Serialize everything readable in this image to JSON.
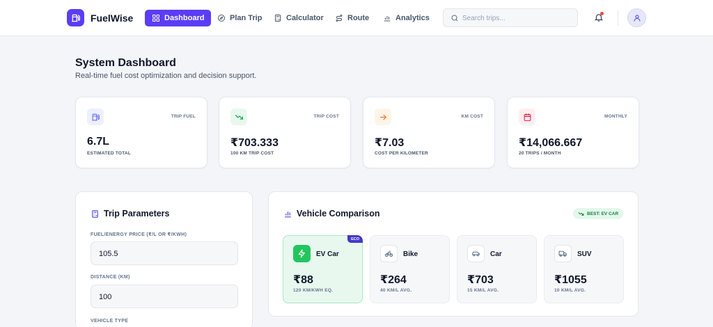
{
  "header": {
    "brand": "FuelWise",
    "nav": [
      {
        "label": "Dashboard",
        "icon": "grid-icon",
        "active": true
      },
      {
        "label": "Plan Trip",
        "icon": "compass-icon",
        "active": false
      },
      {
        "label": "Calculator",
        "icon": "calculator-icon",
        "active": false
      },
      {
        "label": "Route",
        "icon": "route-icon",
        "active": false
      },
      {
        "label": "Analytics",
        "icon": "bar-chart-icon",
        "active": false
      }
    ],
    "search_placeholder": "Search trips...",
    "notifications_unread": true
  },
  "page": {
    "title": "System Dashboard",
    "subtitle": "Real-time fuel cost optimization and decision support."
  },
  "kpis": [
    {
      "tag": "TRIP FUEL",
      "value": "6.7L",
      "caption": "ESTIMATED TOTAL",
      "icon": "fuel-pump-icon",
      "color": "#6366f1"
    },
    {
      "tag": "TRIP COST",
      "value": "₹703.333",
      "caption": "100 KM TRIP COST",
      "icon": "trend-down-icon",
      "color": "#16a34a"
    },
    {
      "tag": "KM COST",
      "value": "₹7.03",
      "caption": "COST PER KILOMETER",
      "icon": "arrow-right-icon",
      "color": "#f97316"
    },
    {
      "tag": "MONTHLY",
      "value": "₹14,066.667",
      "caption": "20 TRIPS / MONTH",
      "icon": "calendar-icon",
      "color": "#e11d48"
    }
  ],
  "trip_parameters": {
    "title": "Trip Parameters",
    "fields": [
      {
        "label": "FUEL/ENERGY PRICE (₹/L OR ₹/KWH)",
        "value": "105.5"
      },
      {
        "label": "DISTANCE (KM)",
        "value": "100"
      },
      {
        "label": "VEHICLE TYPE",
        "value": ""
      }
    ]
  },
  "vehicle_comparison": {
    "title": "Vehicle Comparison",
    "best_badge": "BEST: EV CAR",
    "vehicles": [
      {
        "name": "EV Car",
        "cost": "₹88",
        "efficiency": "120 KM/KWH EQ.",
        "badge": "ECO",
        "best": true,
        "icon": "lightning-icon"
      },
      {
        "name": "Bike",
        "cost": "₹264",
        "efficiency": "40 KM/L AVG.",
        "best": false,
        "icon": "bike-icon"
      },
      {
        "name": "Car",
        "cost": "₹703",
        "efficiency": "15 KM/L AVG.",
        "best": false,
        "icon": "car-icon"
      },
      {
        "name": "SUV",
        "cost": "₹1055",
        "efficiency": "10 KM/L AVG.",
        "best": false,
        "icon": "truck-icon"
      }
    ]
  },
  "colors": {
    "accent": "#5b3df5",
    "success": "#22c55e",
    "eco_badge": "#4338ca"
  }
}
